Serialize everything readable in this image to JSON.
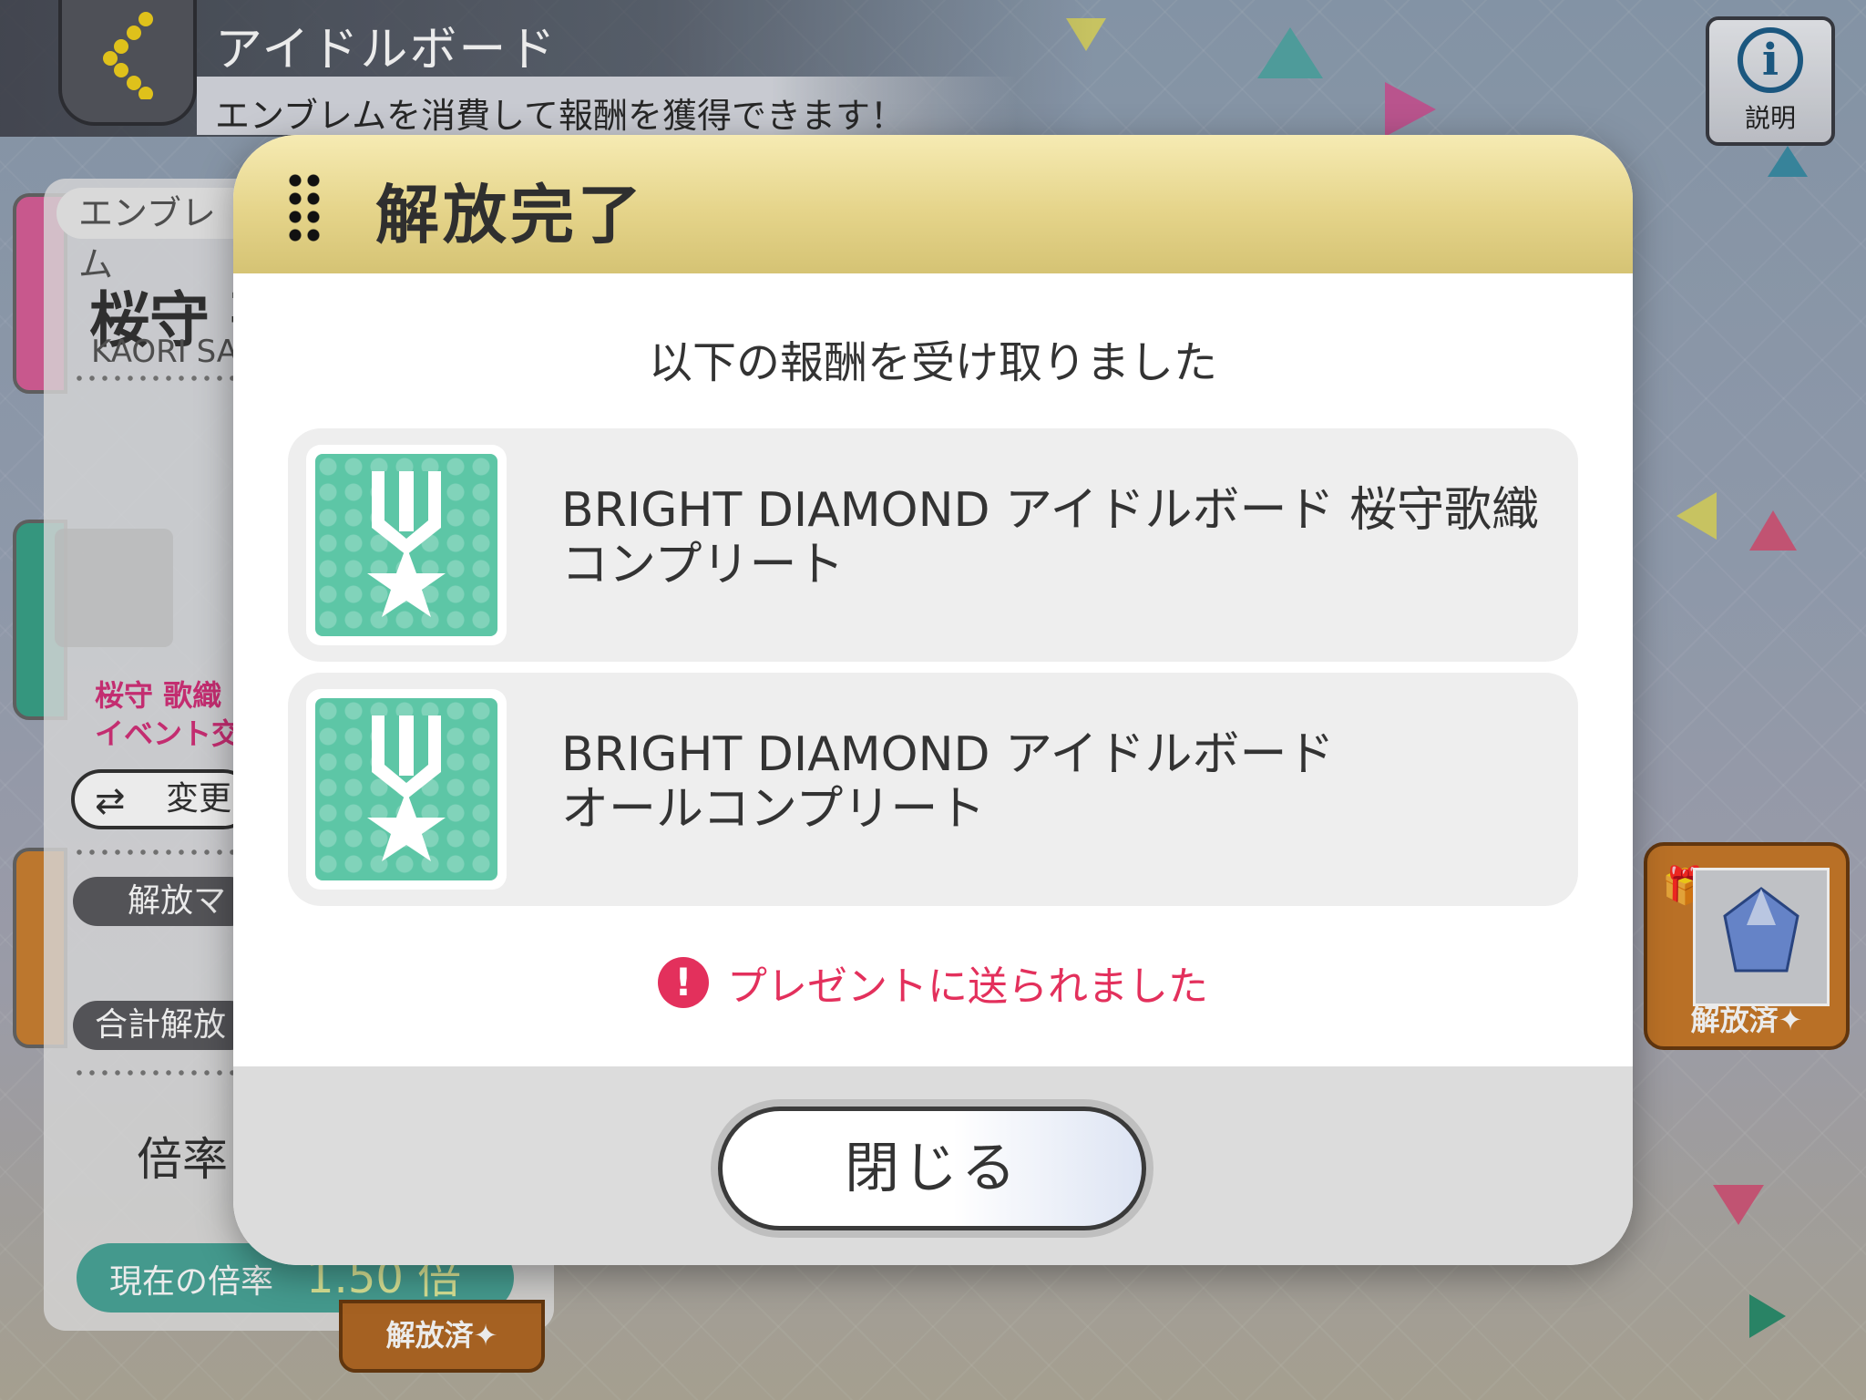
{
  "header": {
    "title": "アイドルボード",
    "subtitle": "エンブレムを消費して報酬を獲得できます！",
    "info_label": "説明",
    "info_glyph": "i"
  },
  "background_panel": {
    "emblem_tab": "エンブレム",
    "name_jp": "桜守 歌",
    "name_en": "KAORI SA",
    "event_line1": "桜守 歌織",
    "event_line2": "イベント交",
    "change_label": "変更",
    "release_tag": "解放マ",
    "total_tag": "合計解放",
    "multiplier_label": "倍率",
    "current_rate_label": "現在の倍率",
    "current_rate_value": "1.50 倍",
    "released_label": "解放済✦"
  },
  "modal": {
    "title": "解放完了",
    "message": "以下の報酬を受け取りました",
    "rewards": [
      {
        "line1": "BRIGHT DIAMOND アイドルボード 桜守歌織",
        "line2": "コンプリート",
        "icon": "medal-icon"
      },
      {
        "line1": "BRIGHT DIAMOND アイドルボード",
        "line2": "オールコンプリート",
        "icon": "medal-icon"
      }
    ],
    "notice": "プレゼントに送られました",
    "notice_glyph": "!",
    "close_label": "閉じる"
  },
  "colors": {
    "header_gold": "#e5d48a",
    "medal_green": "#5dc6a6",
    "notice_red": "#e3305c",
    "rate_teal": "#4aa79a"
  }
}
